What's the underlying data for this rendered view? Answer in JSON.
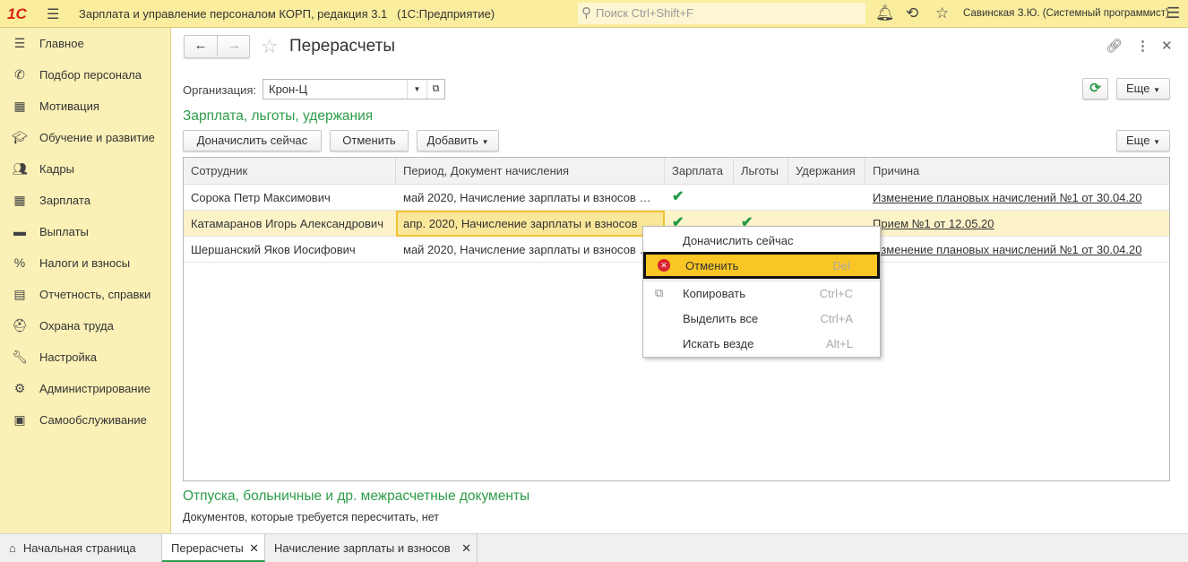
{
  "topbar": {
    "logo": "1С",
    "title": "Зарплата и управление персоналом КОРП, редакция 3.1   (1С:Предприятие)",
    "search_placeholder": "Поиск Ctrl+Shift+F",
    "user": "Савинская З.Ю. (Системный программист)"
  },
  "sidebar": {
    "items": [
      {
        "label": "Главное",
        "icon": "menu-lines-icon"
      },
      {
        "label": "Подбор персонала",
        "icon": "phone-icon"
      },
      {
        "label": "Мотивация",
        "icon": "gift-icon"
      },
      {
        "label": "Обучение и развитие",
        "icon": "graduation-cap-icon"
      },
      {
        "label": "Кадры",
        "icon": "people-icon"
      },
      {
        "label": "Зарплата",
        "icon": "calculator-icon"
      },
      {
        "label": "Выплаты",
        "icon": "wallet-icon"
      },
      {
        "label": "Налоги и взносы",
        "icon": "percent-icon"
      },
      {
        "label": "Отчетность, справки",
        "icon": "reports-icon"
      },
      {
        "label": "Охрана труда",
        "icon": "helmet-icon"
      },
      {
        "label": "Настройка",
        "icon": "wrench-icon"
      },
      {
        "label": "Администрирование",
        "icon": "gear-icon"
      },
      {
        "label": "Самообслуживание",
        "icon": "id-card-icon"
      }
    ]
  },
  "form": {
    "title": "Перерасчеты",
    "org_label": "Организация:",
    "org_value": "Крон-Ц",
    "more_label": "Еще",
    "section1": "Зарплата, льготы, удержания",
    "btn_accrue": "Доначислить сейчас",
    "btn_cancel": "Отменить",
    "btn_add": "Добавить",
    "section2": "Отпуска, больничные и др. межрасчетные документы",
    "section2_note": "Документов, которые требуется пересчитать, нет"
  },
  "table": {
    "columns": [
      "Сотрудник",
      "Период, Документ начисления",
      "Зарплата",
      "Льготы",
      "Удержания",
      "Причина"
    ],
    "rows": [
      {
        "employee": "Сорока Петр Максимович",
        "period": "май 2020, Начисление зарплаты и взносов …",
        "salary": "✔",
        "benefits": "",
        "deductions": "",
        "reason": "Изменение плановых начислений №1 от 30.04.20"
      },
      {
        "employee": "Катамаранов Игорь Александрович",
        "period": "апр. 2020, Начисление зарплаты и взносов …",
        "salary": "✔",
        "benefits": "✔",
        "deductions": "",
        "reason": "Прием №1 от 12.05.20",
        "selected": true
      },
      {
        "employee": "Шершанский Яков Иосифович",
        "period": "май 2020, Начисление зарплаты и взносов …",
        "salary": "",
        "benefits": "",
        "deductions": "",
        "reason": "Изменение плановых начислений №1 от 30.04.20"
      }
    ]
  },
  "context_menu": {
    "items": [
      {
        "label": "Доначислить сейчас",
        "shortcut": ""
      },
      {
        "label": "Отменить",
        "shortcut": "Del",
        "icon": "cancel-icon",
        "highlighted": true
      },
      {
        "label": "Копировать",
        "shortcut": "Ctrl+C",
        "icon": "copy-icon"
      },
      {
        "label": "Выделить все",
        "shortcut": "Ctrl+A"
      },
      {
        "label": "Искать везде",
        "shortcut": "Alt+L"
      }
    ]
  },
  "tabs": [
    {
      "label": "Начальная страница",
      "icon": "home-icon"
    },
    {
      "label": "Перерасчеты",
      "active": true
    },
    {
      "label": "Начисление зарплаты и взносов"
    }
  ],
  "colors": {
    "accent": "#2e9c4a",
    "highlight": "#f9c623",
    "topbar": "#fbed9e",
    "sidebar": "#fbf0b6"
  }
}
